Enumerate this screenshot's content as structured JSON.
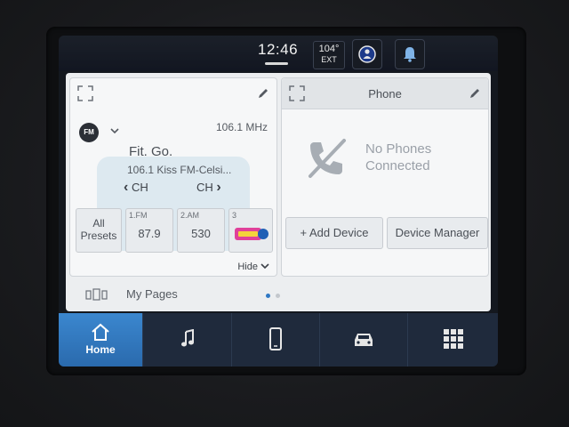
{
  "status": {
    "time": "12:46",
    "temperature": "104°",
    "temperature_label": "EXT"
  },
  "radio": {
    "band": "FM",
    "frequency": "106.1 MHz",
    "song": "Fit. Go.",
    "station": "106.1 Kiss FM-Celsi...",
    "ch_prev": "CH",
    "ch_next": "CH",
    "presets_all": [
      "All",
      "Presets"
    ],
    "presets": [
      {
        "num": "1.FM",
        "value": "87.9"
      },
      {
        "num": "2.AM",
        "value": "530"
      },
      {
        "num": "3",
        "value": ""
      }
    ],
    "hide_label": "Hide"
  },
  "phone": {
    "title": "Phone",
    "status_line1": "No Phones",
    "status_line2": "Connected",
    "add_device": "+ Add Device",
    "device_manager": "Device Manager"
  },
  "pages": {
    "label": "My Pages",
    "count": 2,
    "active_index": 0
  },
  "nav": {
    "items": [
      {
        "label": "Home",
        "icon": "home-icon",
        "active": true
      },
      {
        "label": "",
        "icon": "music-icon"
      },
      {
        "label": "",
        "icon": "phone-icon"
      },
      {
        "label": "",
        "icon": "car-icon"
      },
      {
        "label": "",
        "icon": "apps-grid-icon"
      }
    ]
  },
  "colors": {
    "accent": "#2f78c4",
    "page_dot_active": "#2f78c4",
    "page_dot_inactive": "#c3c7cc"
  }
}
